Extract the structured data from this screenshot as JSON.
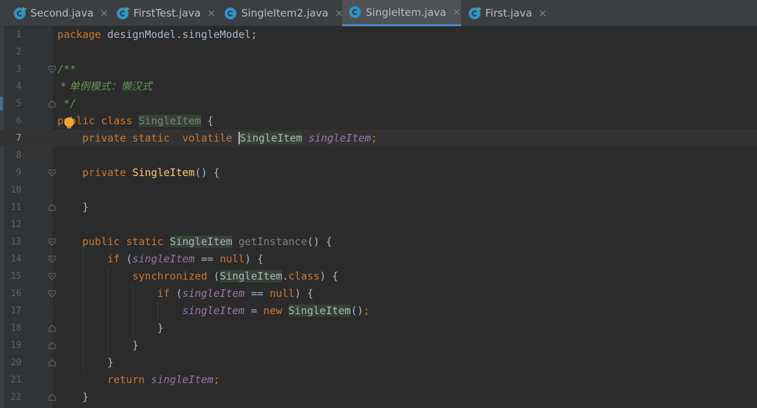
{
  "tabs": [
    {
      "label": "Second.java",
      "icon": "class-run-icon",
      "active": false
    },
    {
      "label": "FirstTest.java",
      "icon": "class-run-icon",
      "active": false
    },
    {
      "label": "SingleItem2.java",
      "icon": "class-icon",
      "active": false
    },
    {
      "label": "SingleItem.java",
      "icon": "class-icon",
      "active": true
    },
    {
      "label": "First.java",
      "icon": "class-run-icon",
      "active": false
    }
  ],
  "close_glyph": "×",
  "tab_icon_letter": "c",
  "editor": {
    "line_numbers": [
      "1",
      "2",
      "3",
      "4",
      "5",
      "6",
      "7",
      "8",
      "9",
      "10",
      "11",
      "12",
      "13",
      "14",
      "15",
      "16",
      "17",
      "18",
      "19",
      "20",
      "21",
      "22"
    ],
    "current_line": 7,
    "tokens": {
      "package_kw": "package",
      "package_name": " designModel.singleModel;",
      "doc_open": "/**",
      "doc_line": " * 单例模式：懒汉式",
      "doc_close": " */",
      "public": "public",
      "class_kw": "class",
      "class_name": "SingleItem",
      "private": "private",
      "static": "static",
      "volatile": "volatile",
      "field": "singleItem",
      "getInstance": "getInstance",
      "if": "if",
      "null": "null",
      "synchronized": "synchronized",
      "class_literal": "class",
      "new": "new",
      "return": "return",
      "open_brace": "{",
      "close_brace": "}"
    }
  },
  "colors": {
    "background": "#2b2b2b",
    "gutter": "#313335",
    "keyword": "#cc7832",
    "comment": "#629755",
    "field": "#9876aa",
    "method": "#ffc66d",
    "text": "#a9b7c6",
    "active_tab_underline": "#4a88c7"
  }
}
